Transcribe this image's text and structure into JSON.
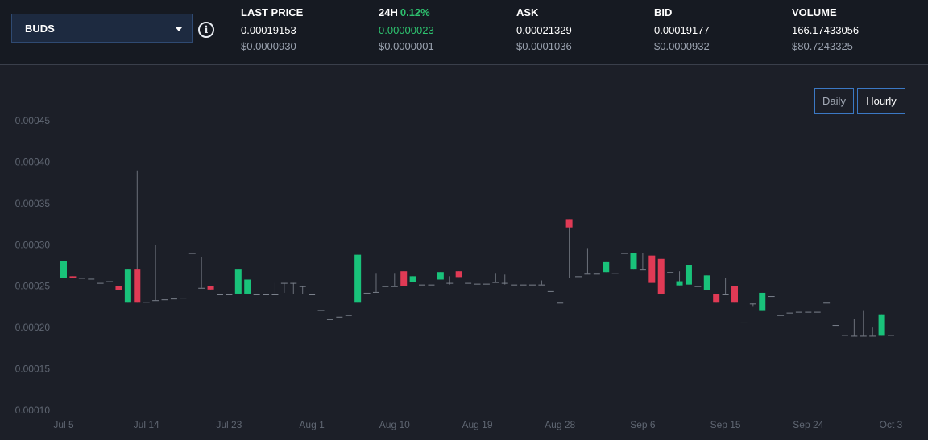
{
  "selector": {
    "value": "BUDS"
  },
  "stats": {
    "last_price": {
      "label": "LAST PRICE",
      "value": "0.00019153",
      "usd": "$0.0000930"
    },
    "change_24h": {
      "label": "24H",
      "pct": "0.12%",
      "value": "0.00000023",
      "usd": "$0.0000001"
    },
    "ask": {
      "label": "ASK",
      "value": "0.00021329",
      "usd": "$0.0001036"
    },
    "bid": {
      "label": "BID",
      "value": "0.00019177",
      "usd": "$0.0000932"
    },
    "volume": {
      "label": "VOLUME",
      "value": "166.17433056",
      "usd": "$80.7243325"
    }
  },
  "range_buttons": {
    "daily": "Daily",
    "hourly": "Hourly"
  },
  "colors": {
    "up": "#19c27a",
    "down": "#e03a55",
    "wick": "#6b707a",
    "flat": "#7a808b",
    "axis_text": "#5f6672",
    "active_button": "#3b78c4"
  },
  "chart_data": {
    "type": "candlestick",
    "ylim": [
      0.0001,
      0.00045
    ],
    "y_ticks": [
      "0.00010",
      "0.00015",
      "0.00020",
      "0.00025",
      "0.00030",
      "0.00035",
      "0.00040",
      "0.00045"
    ],
    "x_ticks": [
      {
        "day": 0,
        "label": "Jul 5"
      },
      {
        "day": 9,
        "label": "Jul 14"
      },
      {
        "day": 18,
        "label": "Jul 23"
      },
      {
        "day": 27,
        "label": "Aug 1"
      },
      {
        "day": 36,
        "label": "Aug 10"
      },
      {
        "day": 45,
        "label": "Aug 19"
      },
      {
        "day": 54,
        "label": "Aug 28"
      },
      {
        "day": 63,
        "label": "Sep 6"
      },
      {
        "day": 72,
        "label": "Sep 15"
      },
      {
        "day": 81,
        "label": "Sep 24"
      },
      {
        "day": 90,
        "label": "Oct 3"
      }
    ],
    "candles": [
      {
        "day": 0.0,
        "open": 0.00026,
        "close": 0.00028,
        "high": 0.00028,
        "low": 0.00026
      },
      {
        "day": 1.0,
        "open": 0.000262,
        "close": 0.00026,
        "high": 0.000262,
        "low": 0.00026
      },
      {
        "day": 2.0,
        "open": 0.00026,
        "close": 0.00026,
        "high": 0.00026,
        "low": 0.00026
      },
      {
        "day": 3.0,
        "open": 0.000259,
        "close": 0.000259,
        "high": 0.000259,
        "low": 0.000259
      },
      {
        "day": 4.0,
        "open": 0.000254,
        "close": 0.000254,
        "high": 0.000254,
        "low": 0.000254
      },
      {
        "day": 5.0,
        "open": 0.000256,
        "close": 0.000256,
        "high": 0.000256,
        "low": 0.000256
      },
      {
        "day": 6.0,
        "open": 0.00025,
        "close": 0.000245,
        "high": 0.00025,
        "low": 0.000245
      },
      {
        "day": 7.0,
        "open": 0.00023,
        "close": 0.00027,
        "high": 0.00027,
        "low": 0.00023
      },
      {
        "day": 8.0,
        "open": 0.00027,
        "close": 0.00023,
        "high": 0.00039,
        "low": 0.00023
      },
      {
        "day": 9.0,
        "open": 0.000231,
        "close": 0.000231,
        "high": 0.000231,
        "low": 0.000231
      },
      {
        "day": 10.0,
        "open": 0.000233,
        "close": 0.000233,
        "high": 0.0003,
        "low": 0.000233
      },
      {
        "day": 11.0,
        "open": 0.000234,
        "close": 0.000234,
        "high": 0.000234,
        "low": 0.000234
      },
      {
        "day": 12.0,
        "open": 0.000235,
        "close": 0.000235,
        "high": 0.000235,
        "low": 0.000235
      },
      {
        "day": 13.0,
        "open": 0.000236,
        "close": 0.000236,
        "high": 0.000236,
        "low": 0.000236
      },
      {
        "day": 14.0,
        "open": 0.00029,
        "close": 0.00029,
        "high": 0.00029,
        "low": 0.00029
      },
      {
        "day": 15.0,
        "open": 0.000248,
        "close": 0.000248,
        "high": 0.000285,
        "low": 0.000248
      },
      {
        "day": 16.0,
        "open": 0.00025,
        "close": 0.000246,
        "high": 0.00025,
        "low": 0.000246
      },
      {
        "day": 17.0,
        "open": 0.00024,
        "close": 0.00024,
        "high": 0.00024,
        "low": 0.00024
      },
      {
        "day": 18.0,
        "open": 0.00024,
        "close": 0.00024,
        "high": 0.00024,
        "low": 0.00024
      },
      {
        "day": 19.0,
        "open": 0.000241,
        "close": 0.00027,
        "high": 0.00027,
        "low": 0.000241
      },
      {
        "day": 20.0,
        "open": 0.000241,
        "close": 0.000258,
        "high": 0.000258,
        "low": 0.000241
      },
      {
        "day": 21.0,
        "open": 0.00024,
        "close": 0.00024,
        "high": 0.00024,
        "low": 0.00024
      },
      {
        "day": 22.0,
        "open": 0.00024,
        "close": 0.00024,
        "high": 0.00024,
        "low": 0.00024
      },
      {
        "day": 23.0,
        "open": 0.00024,
        "close": 0.00024,
        "high": 0.000254,
        "low": 0.00024
      },
      {
        "day": 24.0,
        "open": 0.000254,
        "close": 0.000254,
        "high": 0.000254,
        "low": 0.000242
      },
      {
        "day": 25.0,
        "open": 0.000254,
        "close": 0.000254,
        "high": 0.000254,
        "low": 0.00024
      },
      {
        "day": 26.0,
        "open": 0.00025,
        "close": 0.00025,
        "high": 0.00025,
        "low": 0.00024
      },
      {
        "day": 27.0,
        "open": 0.00024,
        "close": 0.00024,
        "high": 0.00024,
        "low": 0.00024
      },
      {
        "day": 28.0,
        "open": 0.000221,
        "close": 0.000221,
        "high": 0.000221,
        "low": 0.00012
      },
      {
        "day": 29.0,
        "open": 0.00021,
        "close": 0.00021,
        "high": 0.00021,
        "low": 0.00021
      },
      {
        "day": 30.0,
        "open": 0.000213,
        "close": 0.000213,
        "high": 0.000213,
        "low": 0.000213
      },
      {
        "day": 31.0,
        "open": 0.000215,
        "close": 0.000215,
        "high": 0.000215,
        "low": 0.000215
      },
      {
        "day": 32.0,
        "open": 0.00023,
        "close": 0.000288,
        "high": 0.000288,
        "low": 0.00023
      },
      {
        "day": 33.0,
        "open": 0.000242,
        "close": 0.000242,
        "high": 0.000242,
        "low": 0.000242
      },
      {
        "day": 34.0,
        "open": 0.000243,
        "close": 0.000243,
        "high": 0.000265,
        "low": 0.000243
      },
      {
        "day": 35.0,
        "open": 0.00025,
        "close": 0.00025,
        "high": 0.00025,
        "low": 0.00025
      },
      {
        "day": 36.0,
        "open": 0.00025,
        "close": 0.00025,
        "high": 0.000265,
        "low": 0.00025
      },
      {
        "day": 37.0,
        "open": 0.000268,
        "close": 0.00025,
        "high": 0.000268,
        "low": 0.00025
      },
      {
        "day": 38.0,
        "open": 0.000255,
        "close": 0.000262,
        "high": 0.000262,
        "low": 0.000255
      },
      {
        "day": 39.0,
        "open": 0.000252,
        "close": 0.000252,
        "high": 0.000252,
        "low": 0.000252
      },
      {
        "day": 40.0,
        "open": 0.000252,
        "close": 0.000252,
        "high": 0.000252,
        "low": 0.000252
      },
      {
        "day": 41.0,
        "open": 0.000258,
        "close": 0.000267,
        "high": 0.000267,
        "low": 0.000258
      },
      {
        "day": 42.0,
        "open": 0.000254,
        "close": 0.000254,
        "high": 0.000262,
        "low": 0.000252
      },
      {
        "day": 43.0,
        "open": 0.000268,
        "close": 0.000261,
        "high": 0.000268,
        "low": 0.000261
      },
      {
        "day": 44.0,
        "open": 0.000254,
        "close": 0.000254,
        "high": 0.000254,
        "low": 0.000254
      },
      {
        "day": 45.0,
        "open": 0.000253,
        "close": 0.000253,
        "high": 0.000253,
        "low": 0.000253
      },
      {
        "day": 46.0,
        "open": 0.000253,
        "close": 0.000253,
        "high": 0.000253,
        "low": 0.000253
      },
      {
        "day": 47.0,
        "open": 0.000255,
        "close": 0.000255,
        "high": 0.000265,
        "low": 0.000255
      },
      {
        "day": 48.0,
        "open": 0.000254,
        "close": 0.000254,
        "high": 0.000264,
        "low": 0.000252
      },
      {
        "day": 49.0,
        "open": 0.000252,
        "close": 0.000252,
        "high": 0.000252,
        "low": 0.000252
      },
      {
        "day": 50.0,
        "open": 0.000252,
        "close": 0.000252,
        "high": 0.000252,
        "low": 0.000252
      },
      {
        "day": 51.0,
        "open": 0.000252,
        "close": 0.000252,
        "high": 0.000252,
        "low": 0.000252
      },
      {
        "day": 52.0,
        "open": 0.000252,
        "close": 0.000252,
        "high": 0.000257,
        "low": 0.000252
      },
      {
        "day": 53.0,
        "open": 0.000244,
        "close": 0.000244,
        "high": 0.000244,
        "low": 0.000244
      },
      {
        "day": 54.0,
        "open": 0.00023,
        "close": 0.00023,
        "high": 0.00023,
        "low": 0.00023
      },
      {
        "day": 55.0,
        "open": 0.000331,
        "close": 0.000321,
        "high": 0.000331,
        "low": 0.00026
      },
      {
        "day": 56.0,
        "open": 0.000262,
        "close": 0.000262,
        "high": 0.000262,
        "low": 0.000262
      },
      {
        "day": 57.0,
        "open": 0.000265,
        "close": 0.000265,
        "high": 0.000296,
        "low": 0.000265
      },
      {
        "day": 58.0,
        "open": 0.000265,
        "close": 0.000265,
        "high": 0.000265,
        "low": 0.000265
      },
      {
        "day": 59.0,
        "open": 0.000267,
        "close": 0.000279,
        "high": 0.000279,
        "low": 0.000267
      },
      {
        "day": 60.0,
        "open": 0.000266,
        "close": 0.000266,
        "high": 0.000266,
        "low": 0.000266
      },
      {
        "day": 61.0,
        "open": 0.00029,
        "close": 0.00029,
        "high": 0.00029,
        "low": 0.00029
      },
      {
        "day": 62.0,
        "open": 0.00027,
        "close": 0.00029,
        "high": 0.00029,
        "low": 0.00027
      },
      {
        "day": 63.0,
        "open": 0.00027,
        "close": 0.00027,
        "high": 0.00029,
        "low": 0.00027
      },
      {
        "day": 64.0,
        "open": 0.000287,
        "close": 0.000254,
        "high": 0.000287,
        "low": 0.000254
      },
      {
        "day": 65.0,
        "open": 0.000283,
        "close": 0.00024,
        "high": 0.000283,
        "low": 0.00024
      },
      {
        "day": 66.0,
        "open": 0.000267,
        "close": 0.000267,
        "high": 0.000267,
        "low": 0.000267
      },
      {
        "day": 67.0,
        "open": 0.000251,
        "close": 0.000256,
        "high": 0.000268,
        "low": 0.000251
      },
      {
        "day": 68.0,
        "open": 0.000252,
        "close": 0.000275,
        "high": 0.000275,
        "low": 0.000252
      },
      {
        "day": 69.0,
        "open": 0.00025,
        "close": 0.00025,
        "high": 0.00025,
        "low": 0.00025
      },
      {
        "day": 70.0,
        "open": 0.000245,
        "close": 0.000263,
        "high": 0.000263,
        "low": 0.000245
      },
      {
        "day": 71.0,
        "open": 0.00024,
        "close": 0.00023,
        "high": 0.00024,
        "low": 0.00023
      },
      {
        "day": 72.0,
        "open": 0.00024,
        "close": 0.00024,
        "high": 0.00026,
        "low": 0.00024
      },
      {
        "day": 73.0,
        "open": 0.00025,
        "close": 0.00023,
        "high": 0.00025,
        "low": 0.00023
      },
      {
        "day": 74.0,
        "open": 0.000206,
        "close": 0.000206,
        "high": 0.000206,
        "low": 0.000206
      },
      {
        "day": 75.0,
        "open": 0.000229,
        "close": 0.000229,
        "high": 0.000229,
        "low": 0.000225
      },
      {
        "day": 76.0,
        "open": 0.00022,
        "close": 0.000242,
        "high": 0.000242,
        "low": 0.00022
      },
      {
        "day": 77.0,
        "open": 0.000238,
        "close": 0.000238,
        "high": 0.000238,
        "low": 0.000238
      },
      {
        "day": 78.0,
        "open": 0.000215,
        "close": 0.000215,
        "high": 0.000215,
        "low": 0.000215
      },
      {
        "day": 79.0,
        "open": 0.000218,
        "close": 0.000218,
        "high": 0.000218,
        "low": 0.000218
      },
      {
        "day": 80.0,
        "open": 0.000219,
        "close": 0.000219,
        "high": 0.000219,
        "low": 0.000219
      },
      {
        "day": 81.0,
        "open": 0.000219,
        "close": 0.000219,
        "high": 0.000219,
        "low": 0.000219
      },
      {
        "day": 82.0,
        "open": 0.000219,
        "close": 0.000219,
        "high": 0.000219,
        "low": 0.000219
      },
      {
        "day": 83.0,
        "open": 0.00023,
        "close": 0.00023,
        "high": 0.00023,
        "low": 0.00023
      },
      {
        "day": 84.0,
        "open": 0.000203,
        "close": 0.000203,
        "high": 0.000203,
        "low": 0.000203
      },
      {
        "day": 85.0,
        "open": 0.000191,
        "close": 0.000191,
        "high": 0.000191,
        "low": 0.000191
      },
      {
        "day": 86.0,
        "open": 0.00019,
        "close": 0.00019,
        "high": 0.00021,
        "low": 0.00019
      },
      {
        "day": 87.0,
        "open": 0.00019,
        "close": 0.00019,
        "high": 0.00022,
        "low": 0.00019
      },
      {
        "day": 88.0,
        "open": 0.00019,
        "close": 0.00019,
        "high": 0.0002,
        "low": 0.00019
      },
      {
        "day": 89.0,
        "open": 0.00019,
        "close": 0.000216,
        "high": 0.000216,
        "low": 0.00019
      },
      {
        "day": 90.0,
        "open": 0.000191,
        "close": 0.000191,
        "high": 0.000191,
        "low": 0.000191
      }
    ]
  }
}
